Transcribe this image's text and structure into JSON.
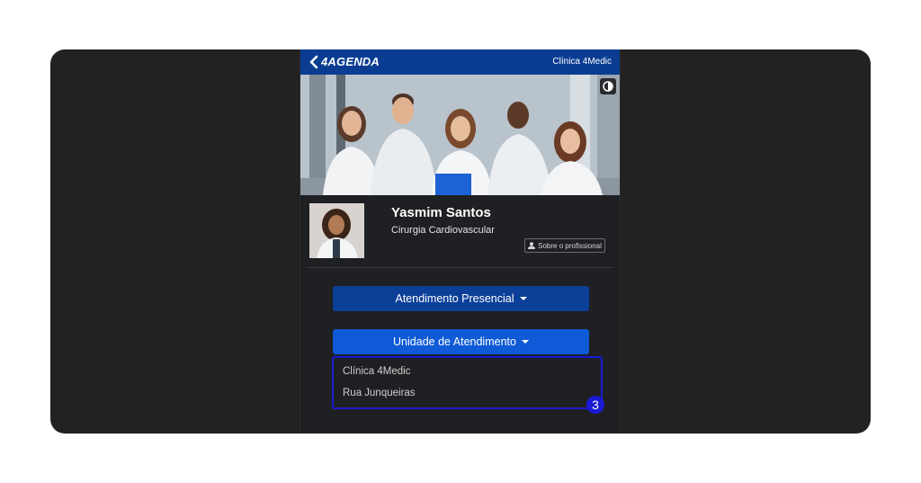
{
  "header": {
    "brand": "4AGENDA",
    "clinic": "Clínica 4Medic"
  },
  "hero": {
    "image": "team of doctors photo",
    "contrast_icon": "contrast-icon"
  },
  "profile": {
    "name": "Yasmim Santos",
    "specialty": "Cirurgia Cardiovascular",
    "about_label": "Sobre o profissional"
  },
  "controls": {
    "attendance_type": "Atendimento Presencial",
    "unit_label": "Unidade de Atendimento"
  },
  "unit_options": [
    "Clínica 4Medic",
    "Rua Junqueiras"
  ],
  "step_badge": "3",
  "colors": {
    "primary_dark": "#0c3f98",
    "primary": "#0f5ad6",
    "highlight": "#1a1ad6",
    "background": "#222222"
  }
}
